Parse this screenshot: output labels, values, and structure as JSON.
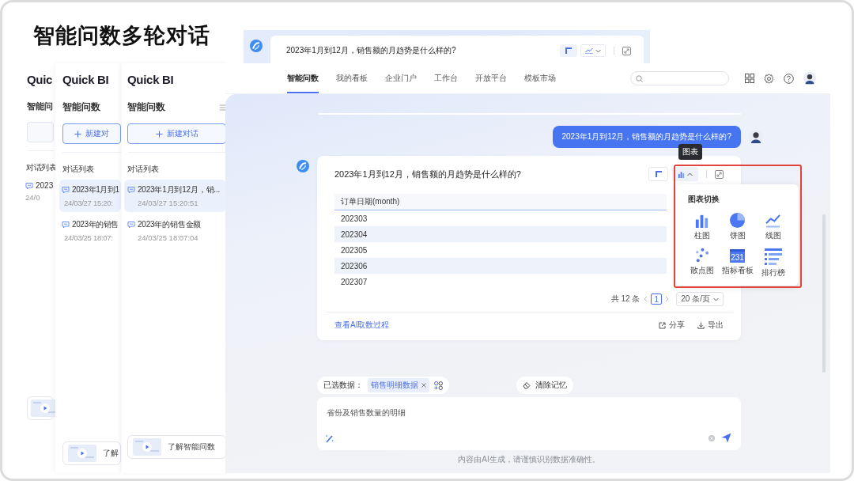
{
  "slide": {
    "title": "智能问数多轮对话"
  },
  "sidebars": [
    {
      "logo": "Quic",
      "heading": "智能问",
      "list_title": "对话列表",
      "conversations": [
        {
          "title": "2023",
          "time": "24/0",
          "selected": false
        }
      ]
    },
    {
      "logo": "Quick BI",
      "heading": "智能问数",
      "new_chat": "新建对",
      "list_title": "对话列表",
      "conversations": [
        {
          "title": "2023年1月到1",
          "time": "24/03/27 15:20:",
          "selected": true
        },
        {
          "title": "2023年的销售",
          "time": "24/03/25 18:07:",
          "selected": false
        }
      ],
      "video_label": "了解"
    },
    {
      "logo": "Quick BI",
      "heading": "智能问数",
      "new_chat": "新建对话",
      "list_title": "对话列表",
      "conversations": [
        {
          "title": "2023年1月到12月，销...",
          "time": "24/03/27 15:20:51",
          "selected": true
        },
        {
          "title": "2023年的销售金额",
          "time": "24/03/25 18:07:04",
          "selected": false
        }
      ],
      "video_label": "了解智能问数"
    }
  ],
  "earlier_answer": {
    "question": "2023年1月到12月，销售额的月趋势是什么样的?"
  },
  "nav": {
    "items": [
      {
        "label": "智能问数",
        "selected": true
      },
      {
        "label": "我的看板",
        "selected": false
      },
      {
        "label": "企业门户",
        "selected": false
      },
      {
        "label": "工作台",
        "selected": false
      },
      {
        "label": "开放平台",
        "selected": false
      },
      {
        "label": "模板市场",
        "selected": false
      }
    ]
  },
  "chat": {
    "user_message": "2023年1月到12月，销售额的月趋势是什么样的?",
    "answer": {
      "question": "2023年1月到12月，销售额的月趋势是什么样的?",
      "tooltip": "图表",
      "table": {
        "columns": [
          "订单日期(month)"
        ],
        "rows": [
          [
            "202303"
          ],
          [
            "202304"
          ],
          [
            "202305"
          ],
          [
            "202306"
          ],
          [
            "202307"
          ]
        ]
      },
      "pagination": {
        "total": "共 12 条",
        "page": "1",
        "page_size": "20 条/页"
      },
      "process_link": "查看AI取数过程",
      "actions": [
        {
          "kind": "share",
          "label": "分享"
        },
        {
          "kind": "export",
          "label": "导出"
        }
      ],
      "chart_menu": {
        "title": "图表切换",
        "options": [
          {
            "kind": "bar",
            "label": "柱图"
          },
          {
            "kind": "pie",
            "label": "饼图"
          },
          {
            "kind": "line",
            "label": "线图"
          },
          {
            "kind": "scatter",
            "label": "散点图"
          },
          {
            "kind": "kpi",
            "label": "指标看板",
            "badge": "231"
          },
          {
            "kind": "ranking",
            "label": "排行榜"
          }
        ]
      }
    }
  },
  "composer": {
    "selected_label": "已选数据：",
    "dataset_tag": "销售明细数据",
    "clear_memory": "清除记忆",
    "value": "省份及销售数量的明细",
    "disclaimer": "内容由AI生成，请谨慎识别数据准确性。"
  }
}
